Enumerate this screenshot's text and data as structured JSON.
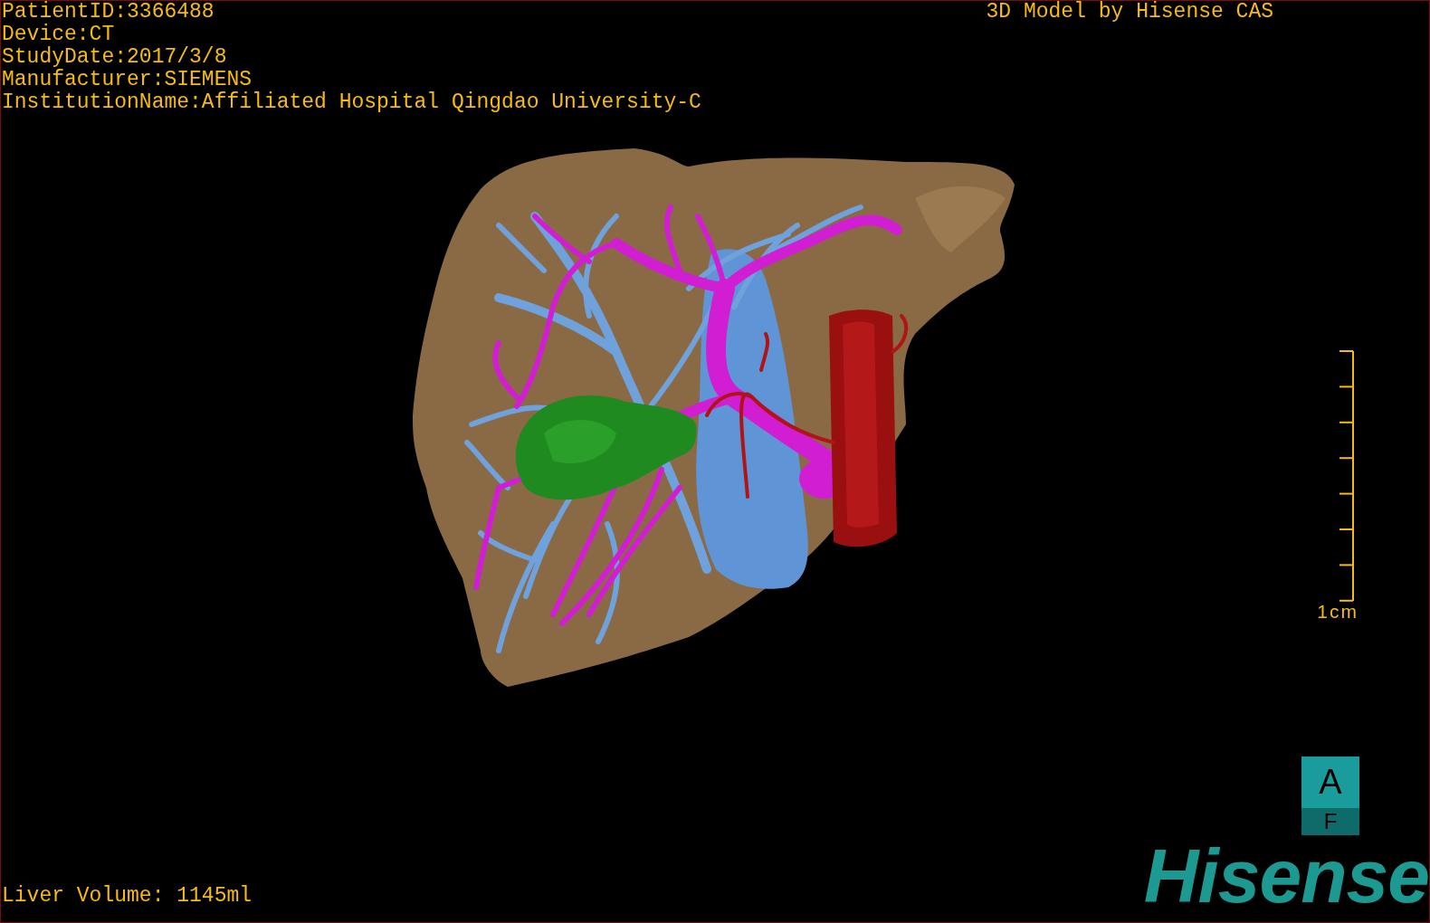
{
  "patient_info": [
    "PatientID:3366488",
    "Device:CT",
    "StudyDate:2017/3/8",
    "Manufacturer:SIEMENS",
    "InstitutionName:Affiliated Hospital Qingdao University-C"
  ],
  "model_title": "3D Model by Hisense CAS",
  "scale_bar": {
    "label": "1cm"
  },
  "orientation_cube": {
    "top": "A",
    "bottom": "F"
  },
  "logo": "Hisense",
  "liver_volume": "Liver Volume: 1145ml"
}
